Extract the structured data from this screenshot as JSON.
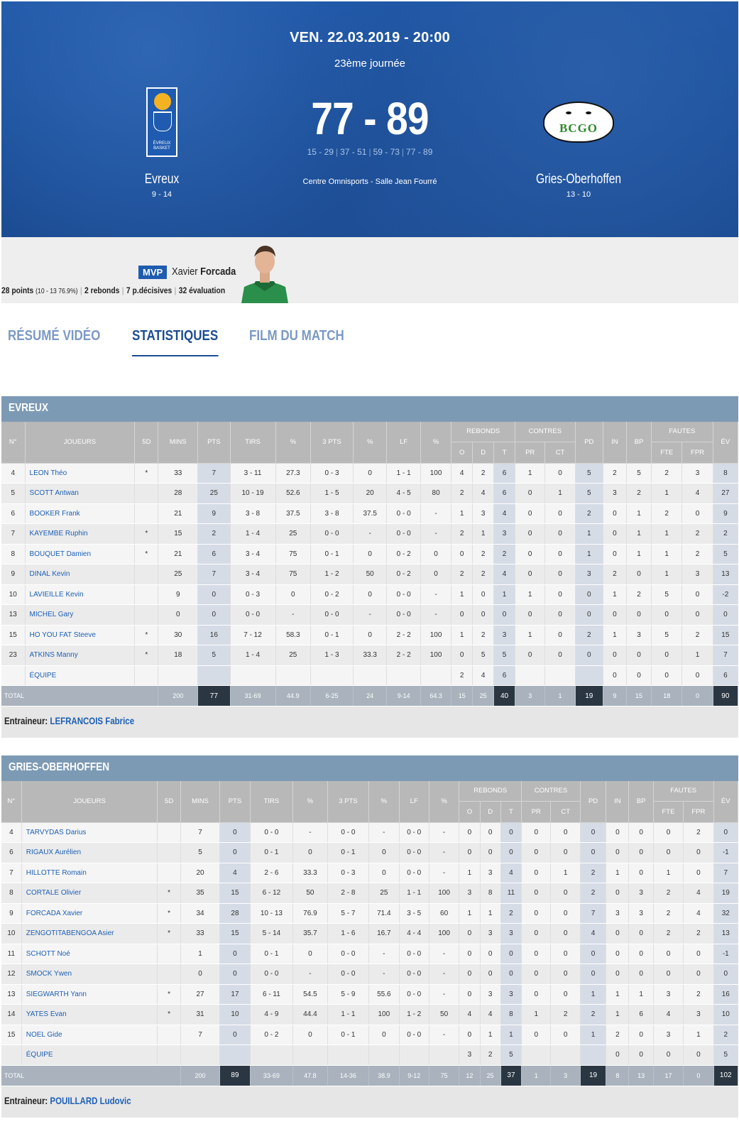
{
  "match": {
    "date": "VEN. 22.03.2019 - 20:00",
    "round": "23ème journée",
    "score": "77 - 89",
    "quarters": [
      "15 - 29",
      "37 - 51",
      "59 - 73",
      "77 - 89"
    ],
    "venue": "Centre Omnisports - Salle Jean Fourré",
    "home": {
      "name": "Evreux",
      "record": "9 - 14",
      "logo_text": [
        "ÉVREUX",
        "BASKET"
      ]
    },
    "away": {
      "name": "Gries-Oberhoffen",
      "record": "13 - 10",
      "logo_text": "BCGO"
    }
  },
  "mvp": {
    "badge": "MVP",
    "first_name": "Xavier",
    "last_name": "Forcada",
    "points": "28 points",
    "shooting": "(10 - 13 76.9%)",
    "rebounds": "2 rebonds",
    "assists": "7 p.décisives",
    "evaluation": "32 évaluation"
  },
  "tabs": [
    {
      "label": "RÉSUMÉ VIDÉO",
      "active": false
    },
    {
      "label": "STATISTIQUES",
      "active": true
    },
    {
      "label": "FILM DU MATCH",
      "active": false
    }
  ],
  "headers": {
    "num": "N°",
    "players": "JOUEURS",
    "five": "5D",
    "mins": "MINS",
    "pts": "PTS",
    "tirs": "TIRS",
    "pct": "%",
    "three": "3 PTS",
    "lf": "LF",
    "rebonds": "REBONDS",
    "o": "O",
    "d": "D",
    "t": "T",
    "contres": "CONTRES",
    "pr": "PR",
    "ct": "CT",
    "pd": "PD",
    "in": "IN",
    "bp": "BP",
    "fautes": "FAUTES",
    "fte": "FTE",
    "fpr": "FPR",
    "ev": "ÉV"
  },
  "teams": [
    {
      "title": "EVREUX",
      "coach_label": "Entraineur:",
      "coach": "LEFRANCOIS Fabrice",
      "rows": [
        [
          "4",
          "LEON Théo",
          "*",
          "33",
          "7",
          "3 - 11",
          "27.3",
          "0 - 3",
          "0",
          "1 - 1",
          "100",
          "4",
          "2",
          "6",
          "1",
          "0",
          "5",
          "2",
          "5",
          "2",
          "3",
          "8"
        ],
        [
          "5",
          "SCOTT Antwan",
          "",
          "28",
          "25",
          "10 - 19",
          "52.6",
          "1 - 5",
          "20",
          "4 - 5",
          "80",
          "2",
          "4",
          "6",
          "0",
          "1",
          "5",
          "3",
          "2",
          "1",
          "4",
          "27"
        ],
        [
          "6",
          "BOOKER Frank",
          "",
          "21",
          "9",
          "3 - 8",
          "37.5",
          "3 - 8",
          "37.5",
          "0 - 0",
          "-",
          "1",
          "3",
          "4",
          "0",
          "0",
          "2",
          "0",
          "1",
          "2",
          "0",
          "9"
        ],
        [
          "7",
          "KAYEMBE Ruphin",
          "*",
          "15",
          "2",
          "1 - 4",
          "25",
          "0 - 0",
          "-",
          "0 - 0",
          "-",
          "2",
          "1",
          "3",
          "0",
          "0",
          "1",
          "0",
          "1",
          "1",
          "2",
          "2"
        ],
        [
          "8",
          "BOUQUET Damien",
          "*",
          "21",
          "6",
          "3 - 4",
          "75",
          "0 - 1",
          "0",
          "0 - 2",
          "0",
          "0",
          "2",
          "2",
          "0",
          "0",
          "1",
          "0",
          "1",
          "1",
          "2",
          "5"
        ],
        [
          "9",
          "DINAL Kevin",
          "",
          "25",
          "7",
          "3 - 4",
          "75",
          "1 - 2",
          "50",
          "0 - 2",
          "0",
          "2",
          "2",
          "4",
          "0",
          "0",
          "3",
          "2",
          "0",
          "1",
          "3",
          "13"
        ],
        [
          "10",
          "LAVIEILLE Kevin",
          "",
          "9",
          "0",
          "0 - 3",
          "0",
          "0 - 2",
          "0",
          "0 - 0",
          "-",
          "1",
          "0",
          "1",
          "1",
          "0",
          "0",
          "1",
          "2",
          "5",
          "0",
          "-2"
        ],
        [
          "13",
          "MICHEL Gary",
          "",
          "0",
          "0",
          "0 - 0",
          "-",
          "0 - 0",
          "-",
          "0 - 0",
          "-",
          "0",
          "0",
          "0",
          "0",
          "0",
          "0",
          "0",
          "0",
          "0",
          "0",
          "0"
        ],
        [
          "15",
          "HO YOU FAT Steeve",
          "*",
          "30",
          "16",
          "7 - 12",
          "58.3",
          "0 - 1",
          "0",
          "2 - 2",
          "100",
          "1",
          "2",
          "3",
          "1",
          "0",
          "2",
          "1",
          "3",
          "5",
          "2",
          "15"
        ],
        [
          "23",
          "ATKINS Manny",
          "*",
          "18",
          "5",
          "1 - 4",
          "25",
          "1 - 3",
          "33.3",
          "2 - 2",
          "100",
          "0",
          "5",
          "5",
          "0",
          "0",
          "0",
          "0",
          "0",
          "0",
          "1",
          "7"
        ],
        [
          "",
          "ÉQUIPE",
          "",
          "",
          "",
          "",
          "",
          "",
          "",
          "",
          "",
          "2",
          "4",
          "6",
          "",
          "",
          "",
          "0",
          "0",
          "0",
          "0",
          "6"
        ]
      ],
      "total": [
        "TOTAL",
        "200",
        "77",
        "31-69",
        "44.9",
        "6-25",
        "24",
        "9-14",
        "64.3",
        "15",
        "25",
        "40",
        "3",
        "1",
        "19",
        "9",
        "15",
        "18",
        "0",
        "90"
      ]
    },
    {
      "title": "GRIES-OBERHOFFEN",
      "coach_label": "Entraineur:",
      "coach": "POUILLARD Ludovic",
      "rows": [
        [
          "4",
          "TARVYDAS Darius",
          "",
          "7",
          "0",
          "0 - 0",
          "-",
          "0 - 0",
          "-",
          "0 - 0",
          "-",
          "0",
          "0",
          "0",
          "0",
          "0",
          "0",
          "0",
          "0",
          "0",
          "2",
          "0"
        ],
        [
          "6",
          "RIGAUX Aurélien",
          "",
          "5",
          "0",
          "0 - 1",
          "0",
          "0 - 1",
          "0",
          "0 - 0",
          "-",
          "0",
          "0",
          "0",
          "0",
          "0",
          "0",
          "0",
          "0",
          "0",
          "0",
          "-1"
        ],
        [
          "7",
          "HILLOTTE Romain",
          "",
          "20",
          "4",
          "2 - 6",
          "33.3",
          "0 - 3",
          "0",
          "0 - 0",
          "-",
          "1",
          "3",
          "4",
          "0",
          "1",
          "2",
          "1",
          "0",
          "1",
          "0",
          "7"
        ],
        [
          "8",
          "CORTALE Olivier",
          "*",
          "35",
          "15",
          "6 - 12",
          "50",
          "2 - 8",
          "25",
          "1 - 1",
          "100",
          "3",
          "8",
          "11",
          "0",
          "0",
          "2",
          "0",
          "3",
          "2",
          "4",
          "19"
        ],
        [
          "9",
          "FORCADA Xavier",
          "*",
          "34",
          "28",
          "10 - 13",
          "76.9",
          "5 - 7",
          "71.4",
          "3 - 5",
          "60",
          "1",
          "1",
          "2",
          "0",
          "0",
          "7",
          "3",
          "3",
          "2",
          "4",
          "32"
        ],
        [
          "10",
          "ZENGOTITABENGOA Asier",
          "*",
          "33",
          "15",
          "5 - 14",
          "35.7",
          "1 - 6",
          "16.7",
          "4 - 4",
          "100",
          "0",
          "3",
          "3",
          "0",
          "0",
          "4",
          "0",
          "0",
          "2",
          "2",
          "13"
        ],
        [
          "11",
          "SCHOTT Noé",
          "",
          "1",
          "0",
          "0 - 1",
          "0",
          "0 - 0",
          "-",
          "0 - 0",
          "-",
          "0",
          "0",
          "0",
          "0",
          "0",
          "0",
          "0",
          "0",
          "0",
          "0",
          "-1"
        ],
        [
          "12",
          "SMOCK Ywen",
          "",
          "0",
          "0",
          "0 - 0",
          "-",
          "0 - 0",
          "-",
          "0 - 0",
          "-",
          "0",
          "0",
          "0",
          "0",
          "0",
          "0",
          "0",
          "0",
          "0",
          "0",
          "0"
        ],
        [
          "13",
          "SIEGWARTH Yann",
          "*",
          "27",
          "17",
          "6 - 11",
          "54.5",
          "5 - 9",
          "55.6",
          "0 - 0",
          "-",
          "0",
          "3",
          "3",
          "0",
          "0",
          "1",
          "1",
          "1",
          "3",
          "2",
          "16"
        ],
        [
          "14",
          "YATES Evan",
          "*",
          "31",
          "10",
          "4 - 9",
          "44.4",
          "1 - 1",
          "100",
          "1 - 2",
          "50",
          "4",
          "4",
          "8",
          "1",
          "2",
          "2",
          "1",
          "6",
          "4",
          "3",
          "10"
        ],
        [
          "15",
          "NOEL Gide",
          "",
          "7",
          "0",
          "0 - 2",
          "0",
          "0 - 1",
          "0",
          "0 - 0",
          "-",
          "0",
          "1",
          "1",
          "0",
          "0",
          "1",
          "2",
          "0",
          "3",
          "1",
          "2"
        ],
        [
          "",
          "ÉQUIPE",
          "",
          "",
          "",
          "",
          "",
          "",
          "",
          "",
          "",
          "3",
          "2",
          "5",
          "",
          "",
          "",
          "0",
          "0",
          "0",
          "0",
          "5"
        ]
      ],
      "total": [
        "TOTAL",
        "200",
        "89",
        "33-69",
        "47.8",
        "14-36",
        "38.9",
        "9-12",
        "75",
        "12",
        "25",
        "37",
        "1",
        "3",
        "19",
        "8",
        "13",
        "17",
        "0",
        "102"
      ]
    }
  ]
}
